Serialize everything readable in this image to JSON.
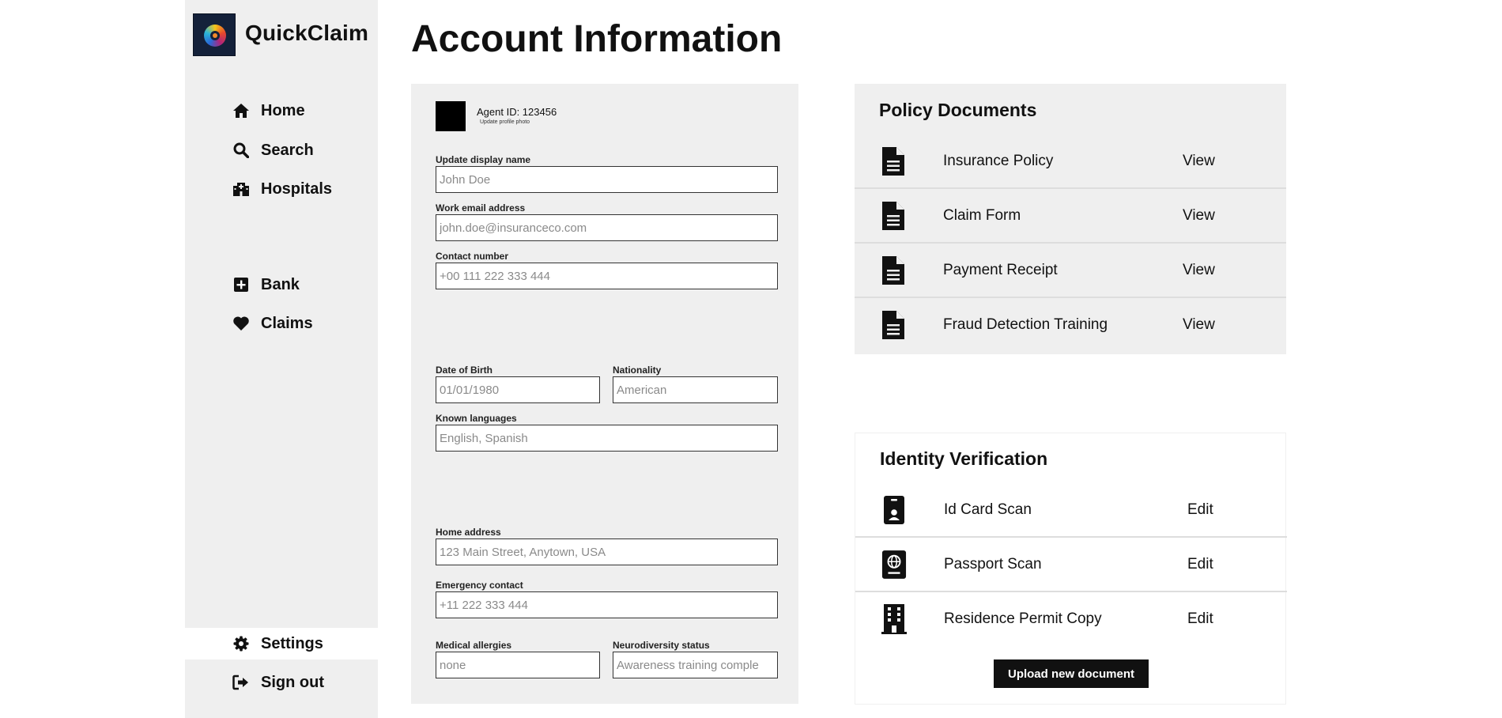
{
  "app": {
    "name": "QuickClaim"
  },
  "sidebar": {
    "items": [
      {
        "label": "Home",
        "icon": "home-icon"
      },
      {
        "label": "Search",
        "icon": "search-icon"
      },
      {
        "label": "Hospitals",
        "icon": "hospital-icon"
      },
      {
        "label": "Bank",
        "icon": "plus-square-icon"
      },
      {
        "label": "Claims",
        "icon": "heart-icon"
      },
      {
        "label": "Settings",
        "icon": "gear-icon",
        "active": true
      },
      {
        "label": "Sign out",
        "icon": "sign-out-icon"
      }
    ]
  },
  "page": {
    "title": "Account Information"
  },
  "profile": {
    "agent_id": "Agent ID: 123456",
    "update_photo": "Update profile photo"
  },
  "form": {
    "display_name": {
      "label": "Update display name",
      "placeholder": "John Doe"
    },
    "email": {
      "label": "Work email address",
      "placeholder": "john.doe@insuranceco.com"
    },
    "contact": {
      "label": "Contact number",
      "placeholder": "+00 111 222 333 444"
    },
    "dob": {
      "label": "Date of Birth",
      "placeholder": "01/01/1980"
    },
    "nationality": {
      "label": "Nationality",
      "placeholder": "American"
    },
    "languages": {
      "label": "Known languages",
      "placeholder": "English, Spanish"
    },
    "address": {
      "label": "Home address",
      "placeholder": "123 Main Street, Anytown, USA"
    },
    "emergency": {
      "label": "Emergency contact",
      "placeholder": "+11 222 333 444"
    },
    "allergies": {
      "label": "Medical allergies",
      "placeholder": "none"
    },
    "neurodiversity": {
      "label": "Neurodiversity status",
      "placeholder": "Awareness training comple"
    }
  },
  "policy_documents": {
    "title": "Policy Documents",
    "rows": [
      {
        "name": "Insurance Policy",
        "action": "View",
        "icon": "document-icon"
      },
      {
        "name": "Claim Form",
        "action": "View",
        "icon": "document-icon"
      },
      {
        "name": "Payment Receipt",
        "action": "View",
        "icon": "document-icon"
      },
      {
        "name": "Fraud Detection Training",
        "action": "View",
        "icon": "document-icon"
      }
    ]
  },
  "identity_verification": {
    "title": "Identity Verification",
    "rows": [
      {
        "name": "Id Card Scan",
        "action": "Edit",
        "icon": "id-badge-icon"
      },
      {
        "name": "Passport Scan",
        "action": "Edit",
        "icon": "passport-icon"
      },
      {
        "name": "Residence Permit Copy",
        "action": "Edit",
        "icon": "building-icon"
      }
    ],
    "upload_label": "Upload new document"
  }
}
